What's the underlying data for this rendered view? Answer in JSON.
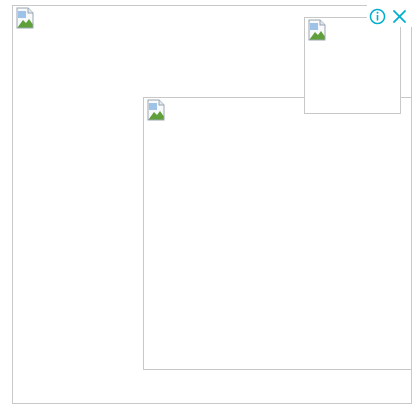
{
  "ad_slot": {
    "images": [
      {
        "icon": "broken-image-icon"
      },
      {
        "icon": "broken-image-icon"
      },
      {
        "icon": "broken-image-icon"
      }
    ],
    "controls": {
      "info_icon": "info-icon",
      "close_icon": "close-icon"
    }
  },
  "colors": {
    "frame_border": "#c8c8c8",
    "control_accent": "#00aecd",
    "background": "#ffffff"
  }
}
